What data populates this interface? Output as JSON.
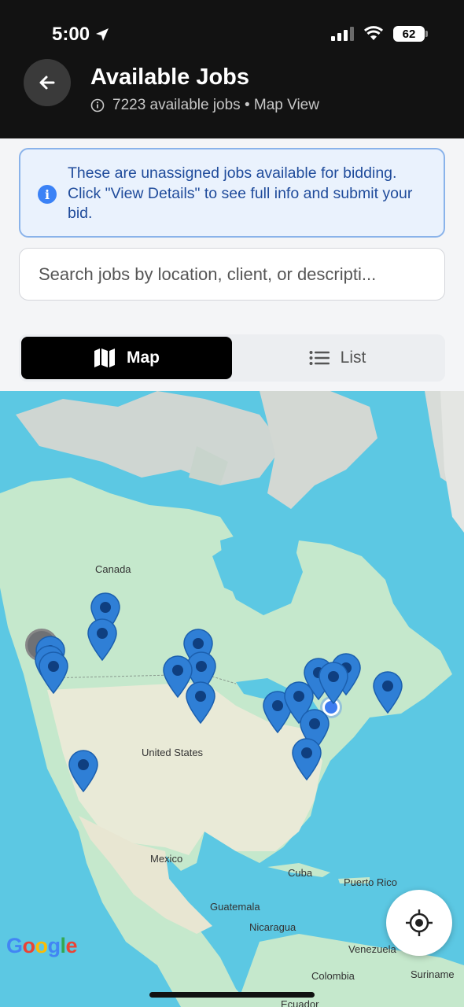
{
  "status_bar": {
    "time": "5:00",
    "battery": "62"
  },
  "header": {
    "title": "Available Jobs",
    "subtitle": "7223 available jobs • Map View"
  },
  "info": {
    "text": "These are unassigned jobs available for bidding. Click \"View Details\" to see full info and submit your bid."
  },
  "search": {
    "placeholder": "Search jobs by location, client, or descripti..."
  },
  "view_toggle": {
    "map_label": "Map",
    "list_label": "List",
    "selected": "Map"
  },
  "map": {
    "attribution": "Google",
    "labels": {
      "canada": "Canada",
      "united_states": "United States",
      "mexico": "Mexico",
      "cuba": "Cuba",
      "puerto_rico": "Puerto Rico",
      "guatemala": "Guatemala",
      "nicaragua": "Nicaragua",
      "venezuela": "Venezuela",
      "colombia": "Colombia",
      "suriname": "Suriname",
      "ecuador": "Ecuador"
    },
    "pin_color": "#2f7fd6",
    "cluster_color": "#6f7175"
  }
}
